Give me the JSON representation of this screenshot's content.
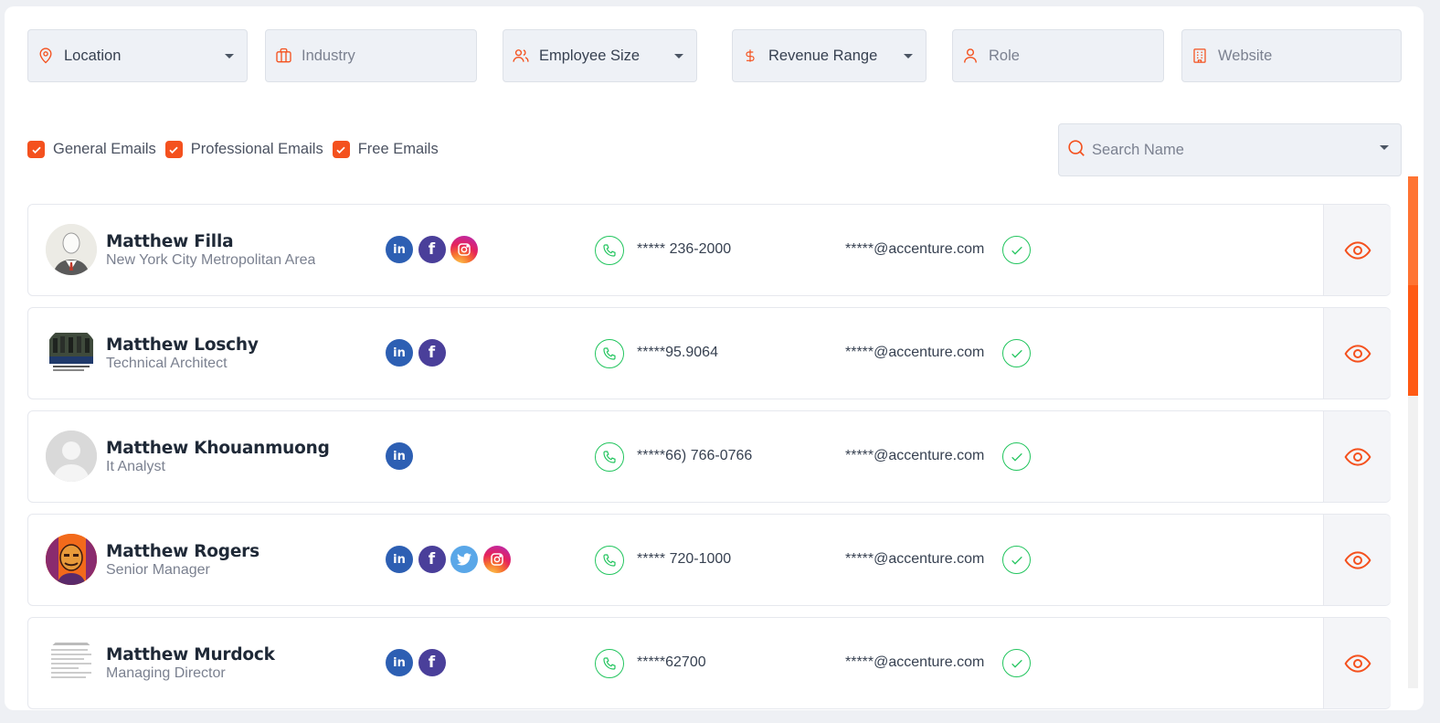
{
  "filters": {
    "location": "Location",
    "industry": "Industry",
    "employee_size": "Employee Size",
    "revenue_range": "Revenue Range",
    "role": "Role",
    "website": "Website"
  },
  "email_filters": [
    {
      "label": "General Emails",
      "checked": true
    },
    {
      "label": "Professional Emails",
      "checked": true
    },
    {
      "label": "Free Emails",
      "checked": true
    }
  ],
  "search": {
    "placeholder": "Search Name"
  },
  "colors": {
    "accent": "#f4511e",
    "verified": "#22c55e",
    "linkedin": "#2d5fb3",
    "facebook": "#4a3f9a"
  },
  "contacts": [
    {
      "name": "Matthew Filla",
      "title": "New York City Metropolitan Area",
      "socials": [
        "linkedin-icon",
        "facebook-icon",
        "instagram-icon"
      ],
      "phone": "***** 236-2000",
      "email": "*****@accenture.com",
      "avatar": "suit-man-avatar"
    },
    {
      "name": "Matthew Loschy",
      "title": "Technical Architect",
      "socials": [
        "linkedin-icon",
        "facebook-icon"
      ],
      "phone": "*****95.9064",
      "email": "*****@accenture.com",
      "avatar": "group-photo-avatar"
    },
    {
      "name": "Matthew Khouanmuong",
      "title": "It Analyst",
      "socials": [
        "linkedin-icon"
      ],
      "phone": "*****66) 766-0766",
      "email": "*****@accenture.com",
      "avatar": "default-avatar"
    },
    {
      "name": "Matthew Rogers",
      "title": "Senior Manager",
      "socials": [
        "linkedin-icon",
        "facebook-icon",
        "twitter-icon",
        "instagram-icon"
      ],
      "phone": "***** 720-1000",
      "email": "*****@accenture.com",
      "avatar": "illustrated-avatar"
    },
    {
      "name": "Matthew Murdock",
      "title": "Managing Director",
      "socials": [
        "linkedin-icon",
        "facebook-icon"
      ],
      "phone": "*****62700",
      "email": "*****@accenture.com",
      "avatar": "document-avatar"
    }
  ]
}
